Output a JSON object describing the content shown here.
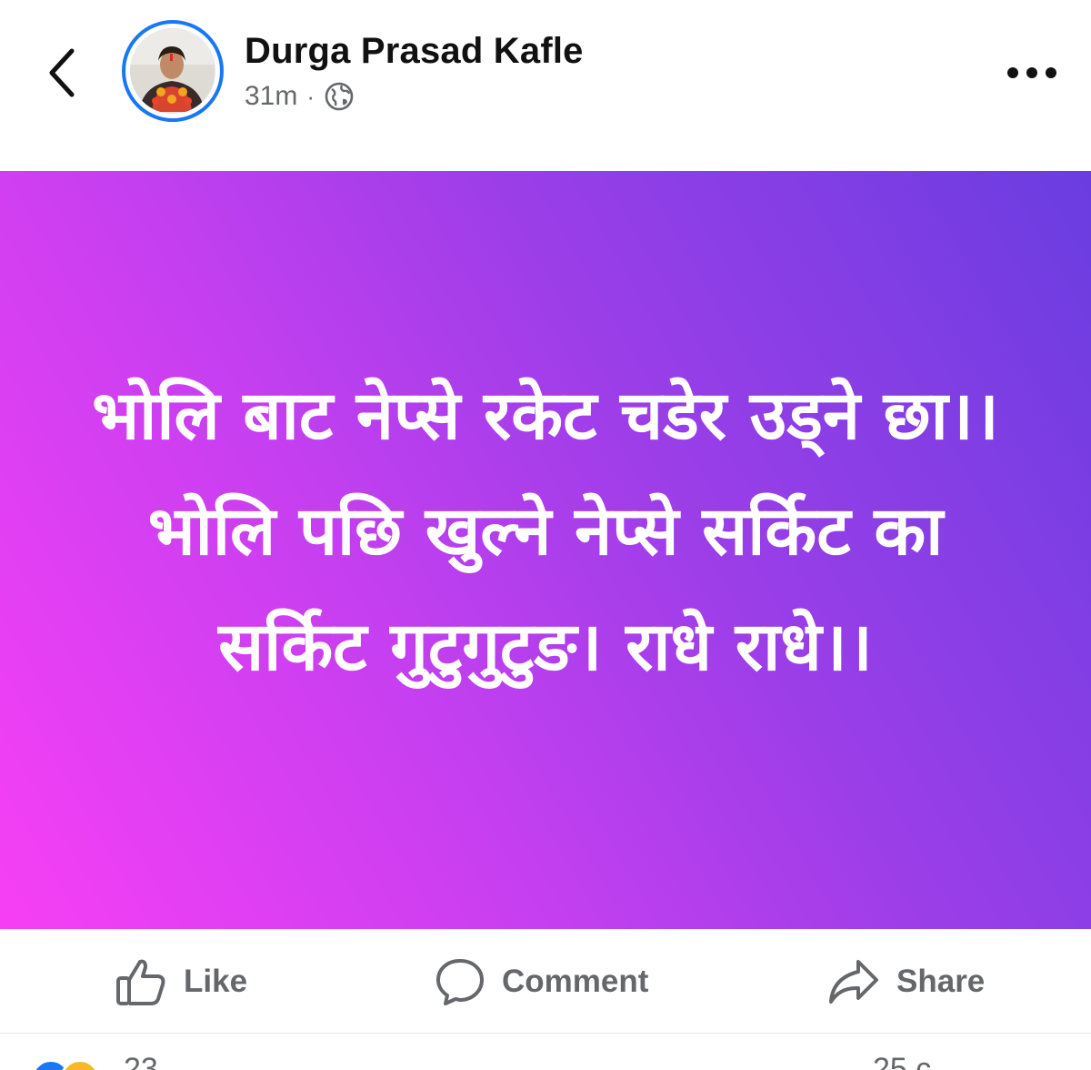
{
  "header": {
    "author_name": "Durga Prasad Kafle",
    "timestamp": "31m",
    "separator": "·",
    "privacy_icon": "globe-icon",
    "back_icon": "chevron-left-icon",
    "more_icon": "more-horizontal-icon"
  },
  "post": {
    "text": "भोलि बाट नेप्से रकेट चडेर उड्ने छा।। भोलि पछि खुल्ने नेप्से सर्किट का सर्किट गुटुगुटुङ। राधे राधे।।",
    "background_gradient": [
      "#f73ff5",
      "#c73ff0",
      "#9a3ee8",
      "#6a3de0"
    ],
    "text_color": "#ffffff"
  },
  "actions": {
    "like_label": "Like",
    "comment_label": "Comment",
    "share_label": "Share",
    "like_icon": "thumbs-up-icon",
    "comment_icon": "comment-bubble-icon",
    "share_icon": "share-arrow-icon"
  },
  "footer": {
    "reaction_count": "23",
    "comment_count": "25 c"
  },
  "colors": {
    "accent": "#1877f2",
    "secondary_text": "#65676b"
  }
}
